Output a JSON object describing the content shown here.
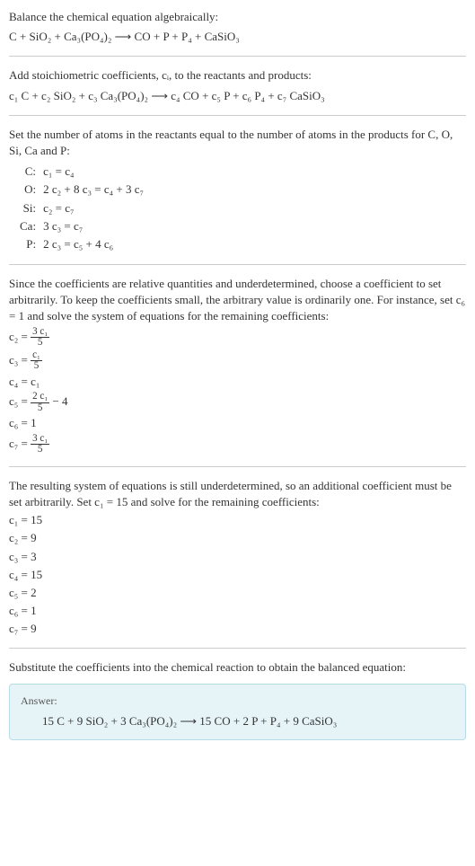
{
  "intro_line1": "Balance the chemical equation algebraically:",
  "intro_eq": "C + SiO₂ + Ca₃(PO₄)₂  ⟶  CO + P + P₄ + CaSiO₃",
  "step1_text": "Add stoichiometric coefficients, cᵢ, to the reactants and products:",
  "step1_eq": "c₁ C + c₂ SiO₂ + c₃ Ca₃(PO₄)₂  ⟶  c₄ CO + c₅ P + c₆ P₄ + c₇ CaSiO₃",
  "step2_text": "Set the number of atoms in the reactants equal to the number of atoms in the products for C, O, Si, Ca and P:",
  "atom_rows": [
    {
      "el": "C:",
      "eq": "c₁ = c₄"
    },
    {
      "el": "O:",
      "eq": "2 c₂ + 8 c₃ = c₄ + 3 c₇"
    },
    {
      "el": "Si:",
      "eq": "c₂ = c₇"
    },
    {
      "el": "Ca:",
      "eq": "3 c₃ = c₇"
    },
    {
      "el": "P:",
      "eq": "2 c₃ = c₅ + 4 c₆"
    }
  ],
  "step3_text": "Since the coefficients are relative quantities and underdetermined, choose a coefficient to set arbitrarily. To keep the coefficients small, the arbitrary value is ordinarily one. For instance, set c₆ = 1 and solve the system of equations for the remaining coefficients:",
  "frac_coeffs": {
    "c2": {
      "lhs": "c₂ =",
      "num": "3 c₁",
      "den": "5"
    },
    "c3": {
      "lhs": "c₃ =",
      "num": "c₁",
      "den": "5"
    },
    "c4": {
      "lhs": "c₄ = c₁"
    },
    "c5": {
      "lhs": "c₅ =",
      "num": "2 c₁",
      "den": "5",
      "tail": " − 4"
    },
    "c6": {
      "lhs": "c₆ = 1"
    },
    "c7": {
      "lhs": "c₇ =",
      "num": "3 c₁",
      "den": "5"
    }
  },
  "step4_text": "The resulting system of equations is still underdetermined, so an additional coefficient must be set arbitrarily. Set c₁ = 15 and solve for the remaining coefficients:",
  "final_coeffs": [
    "c₁ = 15",
    "c₂ = 9",
    "c₃ = 3",
    "c₄ = 15",
    "c₅ = 2",
    "c₆ = 1",
    "c₇ = 9"
  ],
  "step5_text": "Substitute the coefficients into the chemical reaction to obtain the balanced equation:",
  "answer_label": "Answer:",
  "answer_eq": "15 C + 9 SiO₂ + 3 Ca₃(PO₄)₂  ⟶  15 CO + 2 P + P₄ + 9 CaSiO₃"
}
